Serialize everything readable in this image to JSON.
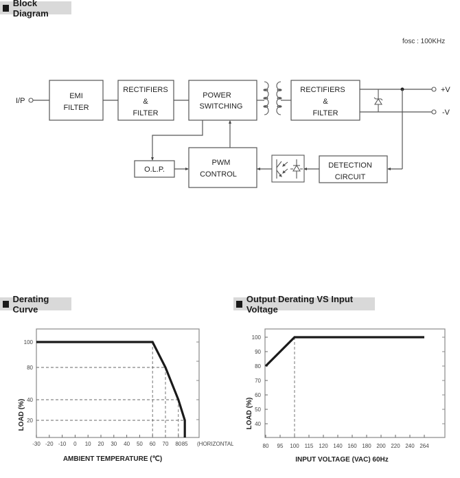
{
  "block_diagram": {
    "title": "Block Diagram",
    "fosc_label": "fosc : 100KHz",
    "input_label": "I/P",
    "output_pos_label": "+V",
    "output_neg_label": "-V",
    "blocks": {
      "emi_filter": [
        "EMI",
        "FILTER"
      ],
      "rectifiers_in": [
        "RECTIFIERS",
        "&",
        "FILTER"
      ],
      "power_switching": [
        "POWER",
        "SWITCHING"
      ],
      "rectifiers_out": [
        "RECTIFIERS",
        "&",
        "FILTER"
      ],
      "olp": [
        "O.L.P."
      ],
      "pwm_control": [
        "PWM",
        "CONTROL"
      ],
      "detection_circuit": [
        "DETECTION",
        "CIRCUIT"
      ]
    },
    "icons": [
      "transformer-icon",
      "zener-diode-icon",
      "optocoupler-icon"
    ]
  },
  "chart_data": [
    {
      "type": "line",
      "title": "Derating Curve",
      "xlabel": "AMBIENT TEMPERATURE (℃)",
      "ylabel": "LOAD (%)",
      "x_ticks": [
        "-30",
        "-20",
        "-10",
        "0",
        "10",
        "20",
        "30",
        "40",
        "50",
        "60",
        "70",
        "80",
        "85"
      ],
      "x_tick_values": [
        -30,
        -20,
        -10,
        0,
        10,
        20,
        30,
        40,
        50,
        60,
        70,
        80,
        85
      ],
      "x_annotation": "(HORIZONTAL)",
      "y_ticks": [
        "100",
        "80",
        "40",
        "20"
      ],
      "y_tick_values": [
        100,
        80,
        40,
        20
      ],
      "xlim": [
        -30,
        95
      ],
      "ylim": [
        0,
        110
      ],
      "grid": false,
      "series": [
        {
          "name": "Load",
          "x": [
            -30,
            60,
            70,
            80,
            85,
            85
          ],
          "y": [
            100,
            100,
            80,
            40,
            20,
            0
          ]
        }
      ],
      "reference_lines": {
        "vertical": [
          60,
          70,
          80
        ],
        "horizontal": [
          80,
          40,
          20
        ]
      }
    },
    {
      "type": "line",
      "title": "Output Derating VS Input Voltage",
      "xlabel": "INPUT VOLTAGE (VAC) 60Hz",
      "ylabel": "LOAD (%)",
      "x_ticks": [
        "80",
        "95",
        "100",
        "115",
        "120",
        "140",
        "160",
        "180",
        "200",
        "220",
        "240",
        "264"
      ],
      "y_ticks": [
        "100",
        "90",
        "80",
        "70",
        "60",
        "50",
        "40"
      ],
      "y_tick_values": [
        100,
        90,
        80,
        70,
        60,
        50,
        40
      ],
      "ylim": [
        30,
        105
      ],
      "grid": false,
      "series": [
        {
          "name": "Load",
          "x": [
            "80",
            "100",
            "264"
          ],
          "y": [
            80,
            100,
            100
          ]
        }
      ],
      "reference_lines": {
        "vertical": [
          "100"
        ]
      }
    }
  ]
}
